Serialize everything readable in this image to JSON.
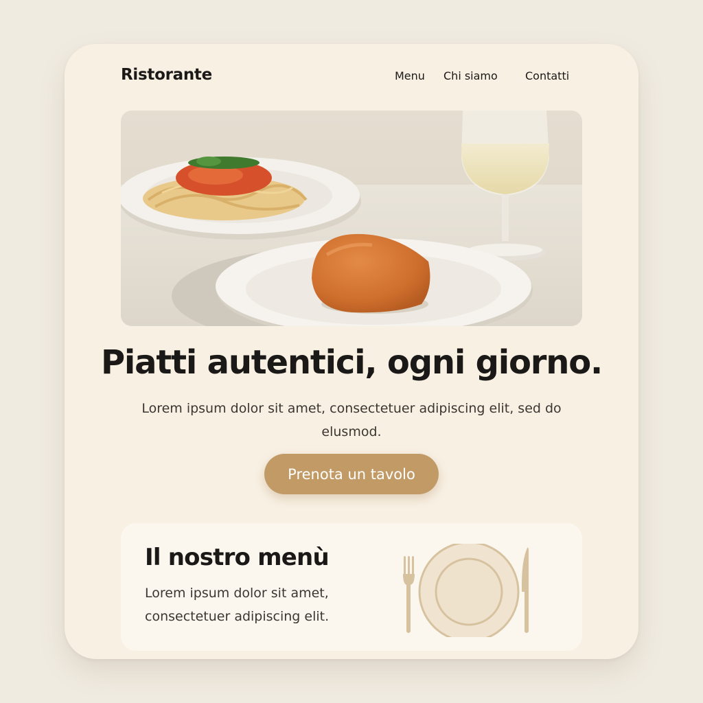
{
  "header": {
    "brand": "Ristorante",
    "nav": [
      {
        "label": "Menu"
      },
      {
        "label": "Chi siamo"
      },
      {
        "label": "Contatti"
      }
    ]
  },
  "hero": {
    "image": "pasta-arancino-wine-photo",
    "headline": "Piatti autentici, ogni giorno.",
    "subtext": "Lorem ipsum dolor sit amet, consectetuer adipiscing elit, sed do elusmod.",
    "cta_label": "Prenota un tavolo"
  },
  "menu_section": {
    "title": "Il nostro menù",
    "description": "Lorem ipsum dolor sit amet, consectetuer adipiscing elit.",
    "icon": "place-setting-icon"
  },
  "colors": {
    "background": "#f0ebe1",
    "card": "#f8f0e3",
    "accent": "#c29a66",
    "text": "#1b1917"
  }
}
